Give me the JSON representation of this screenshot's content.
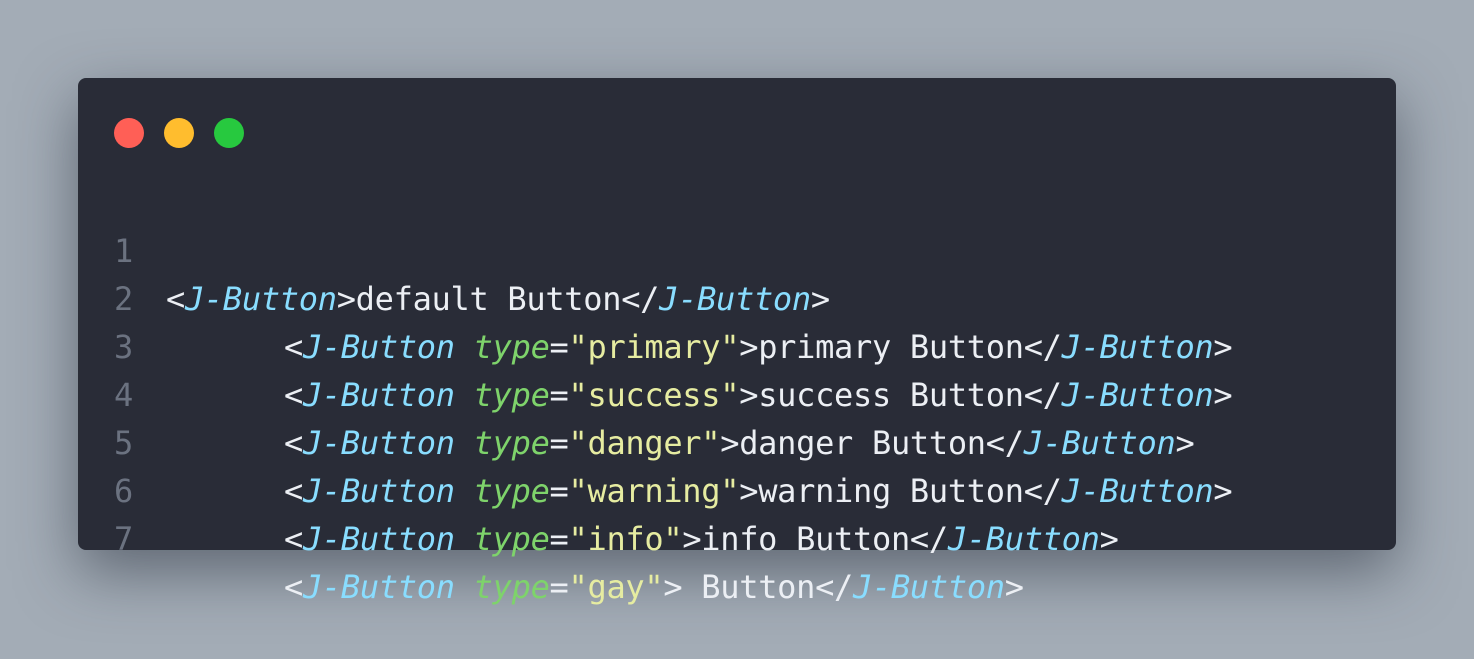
{
  "window": {
    "controls": [
      {
        "name": "close",
        "color": "#ff5f56"
      },
      {
        "name": "minimize",
        "color": "#ffbd2e"
      },
      {
        "name": "maximize",
        "color": "#27c93f"
      }
    ]
  },
  "code": {
    "lines": [
      {
        "number": "1",
        "open": "<",
        "tag": "J-Button",
        "attr": "",
        "eq": "",
        "value": "",
        "close_open": ">",
        "text": "default Button",
        "close_tag_open": "</",
        "close_tag": "J-Button",
        "close_tag_end": ">"
      },
      {
        "number": "2",
        "open": "<",
        "tag": "J-Button",
        "attr": "type",
        "eq": "=",
        "value": "\"primary\"",
        "close_open": ">",
        "text": "primary Button",
        "close_tag_open": "</",
        "close_tag": "J-Button",
        "close_tag_end": ">"
      },
      {
        "number": "3",
        "open": "<",
        "tag": "J-Button",
        "attr": "type",
        "eq": "=",
        "value": "\"success\"",
        "close_open": ">",
        "text": "success Button",
        "close_tag_open": "</",
        "close_tag": "J-Button",
        "close_tag_end": ">"
      },
      {
        "number": "4",
        "open": "<",
        "tag": "J-Button",
        "attr": "type",
        "eq": "=",
        "value": "\"danger\"",
        "close_open": ">",
        "text": "danger Button",
        "close_tag_open": "</",
        "close_tag": "J-Button",
        "close_tag_end": ">"
      },
      {
        "number": "5",
        "open": "<",
        "tag": "J-Button",
        "attr": "type",
        "eq": "=",
        "value": "\"warning\"",
        "close_open": ">",
        "text": "warning Button",
        "close_tag_open": "</",
        "close_tag": "J-Button",
        "close_tag_end": ">"
      },
      {
        "number": "6",
        "open": "<",
        "tag": "J-Button",
        "attr": "type",
        "eq": "=",
        "value": "\"info\"",
        "close_open": ">",
        "text": "info Button",
        "close_tag_open": "</",
        "close_tag": "J-Button",
        "close_tag_end": ">"
      },
      {
        "number": "7",
        "open": "<",
        "tag": "J-Button",
        "attr": "type",
        "eq": "=",
        "value": "\"gay\"",
        "close_open": ">",
        "text": " Button",
        "close_tag_open": "</",
        "close_tag": "J-Button",
        "close_tag_end": ">"
      }
    ]
  },
  "colors": {
    "background": "#a3acb6",
    "window": "#292c37",
    "line_number": "#6b7280",
    "tag": "#89ddff",
    "attribute": "#7ed36b",
    "string": "#e6eca1",
    "text": "#eceff4"
  }
}
